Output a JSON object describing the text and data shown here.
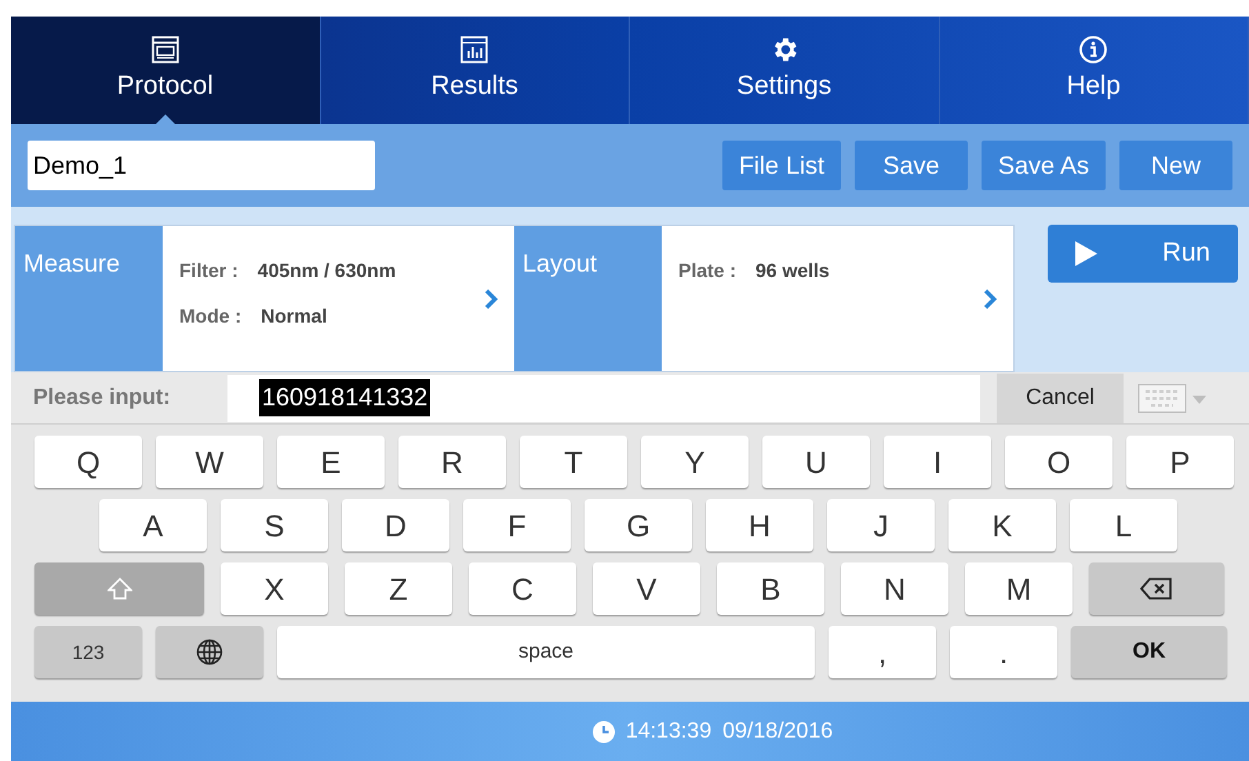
{
  "tabs": [
    {
      "label": "Protocol",
      "kind": "window",
      "selected": true
    },
    {
      "label": "Results",
      "kind": "chart",
      "selected": false
    },
    {
      "label": "Settings",
      "kind": "gear",
      "selected": false
    },
    {
      "label": "Help",
      "kind": "info",
      "selected": false
    }
  ],
  "file_name": {
    "value": "Demo_1"
  },
  "toolbar_buttons": [
    "File List",
    "Save",
    "Save As",
    "New"
  ],
  "cards": [
    {
      "title": "Measure",
      "lines": [
        {
          "label": "Filter :",
          "value": "405nm / 630nm"
        },
        {
          "label": "Mode :",
          "value": "Normal"
        }
      ]
    },
    {
      "title": "Layout",
      "lines": [
        {
          "label": "Plate :",
          "value": "96 wells"
        }
      ]
    }
  ],
  "run_button": "Run",
  "input_bar": {
    "label": "Please input:",
    "value": "160918141332",
    "cancel": "Cancel"
  },
  "keyboard": [
    [
      {
        "kind": "letter",
        "label": "Q"
      },
      {
        "kind": "letter",
        "label": "W"
      },
      {
        "kind": "letter",
        "label": "E"
      },
      {
        "kind": "letter",
        "label": "R"
      },
      {
        "kind": "letter",
        "label": "T"
      },
      {
        "kind": "letter",
        "label": "Y"
      },
      {
        "kind": "letter",
        "label": "U"
      },
      {
        "kind": "letter",
        "label": "I"
      },
      {
        "kind": "letter",
        "label": "O"
      },
      {
        "kind": "letter",
        "label": "P"
      }
    ],
    [
      {
        "kind": "letter",
        "label": "A"
      },
      {
        "kind": "letter",
        "label": "S"
      },
      {
        "kind": "letter",
        "label": "D"
      },
      {
        "kind": "letter",
        "label": "F"
      },
      {
        "kind": "letter",
        "label": "G"
      },
      {
        "kind": "letter",
        "label": "H"
      },
      {
        "kind": "letter",
        "label": "J"
      },
      {
        "kind": "letter",
        "label": "K"
      },
      {
        "kind": "letter",
        "label": "L"
      }
    ],
    [
      {
        "kind": "shift"
      },
      {
        "kind": "letter",
        "label": "X"
      },
      {
        "kind": "letter",
        "label": "Z"
      },
      {
        "kind": "letter",
        "label": "C"
      },
      {
        "kind": "letter",
        "label": "V"
      },
      {
        "kind": "letter",
        "label": "B"
      },
      {
        "kind": "letter",
        "label": "N"
      },
      {
        "kind": "letter",
        "label": "M"
      },
      {
        "kind": "backspace"
      }
    ],
    [
      {
        "kind": "mode",
        "label": "123"
      },
      {
        "kind": "globe"
      },
      {
        "kind": "space",
        "label": "space"
      },
      {
        "kind": "letter",
        "label": ","
      },
      {
        "kind": "letter",
        "label": "."
      },
      {
        "kind": "ok",
        "label": "OK"
      }
    ]
  ],
  "status_bar": {
    "time": "14:13:39",
    "date": "09/18/2016"
  }
}
